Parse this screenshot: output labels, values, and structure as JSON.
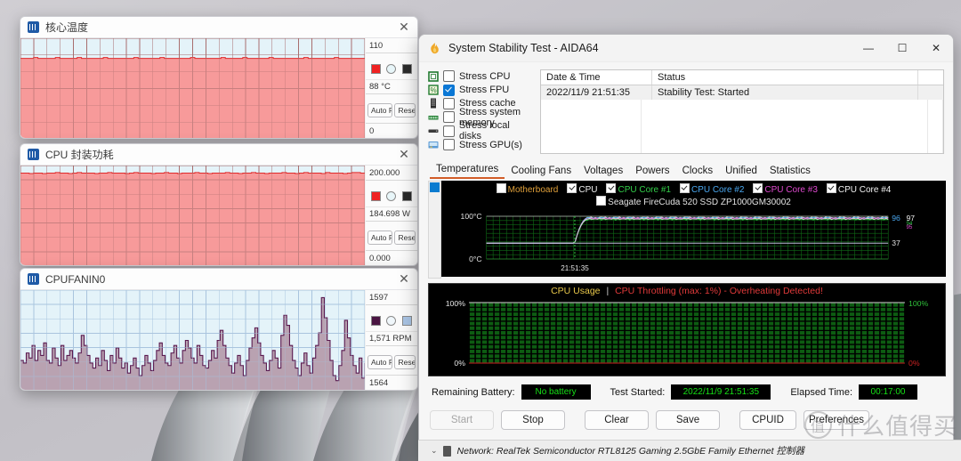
{
  "desktop": {
    "wallpaper_alt": "fan-blades-wallpaper"
  },
  "watermark": {
    "badge": "值",
    "text": "什么值得买"
  },
  "sensor_panels": [
    {
      "title": "核心温度",
      "icon": "sensor-panel-icon",
      "close_label": "✕",
      "max_label": "110",
      "min_label": "0",
      "current_value": "88 °C",
      "auto_fit_label": "Auto Fit",
      "reset_label": "Reset",
      "swatches": [
        "#ef2222",
        "#e8f6f9",
        "#2b2b2b"
      ],
      "series_color": "#ef3b3b",
      "fill_color": "#f79d9d",
      "grid_color": "#b07a7a",
      "bg_color": "#e4f3f9"
    },
    {
      "title": "CPU 封装功耗",
      "icon": "sensor-panel-icon",
      "close_label": "✕",
      "max_label": "200.000",
      "min_label": "0.000",
      "current_value": "184.698 W",
      "auto_fit_label": "Auto Fit",
      "reset_label": "Reset",
      "swatches": [
        "#ef2222",
        "#e8f6f9",
        "#2b2b2b"
      ],
      "series_color": "#ef3b3b",
      "fill_color": "#f79d9d",
      "grid_color": "#b07a7a",
      "bg_color": "#e4f3f9"
    },
    {
      "title": "CPUFANIN0",
      "icon": "sensor-panel-icon",
      "close_label": "✕",
      "max_label": "1597",
      "min_label": "1564",
      "current_value": "1,571 RPM",
      "auto_fit_label": "Auto Fit",
      "reset_label": "Reset",
      "swatches": [
        "#4a1542",
        "#f0f7fb",
        "#a9c4e4"
      ],
      "series_color": "#5a1a50",
      "fill_color": "#b69dad",
      "grid_color": "#aec6de",
      "bg_color": "#e4f3f9"
    }
  ],
  "aida": {
    "window_title": "System Stability Test - AIDA64",
    "window_icon": "aida64-flame-icon",
    "window_buttons": {
      "minimize": "—",
      "maximize": "☐",
      "close": "✕"
    },
    "stress_options": [
      {
        "label": "Stress CPU",
        "checked": false,
        "icon": "cpu-icon"
      },
      {
        "label": "Stress FPU",
        "checked": true,
        "icon": "fpu-icon"
      },
      {
        "label": "Stress cache",
        "checked": false,
        "icon": "cache-icon"
      },
      {
        "label": "Stress system memory",
        "checked": false,
        "icon": "memory-icon"
      },
      {
        "label": "Stress local disks",
        "checked": false,
        "icon": "disk-icon"
      },
      {
        "label": "Stress GPU(s)",
        "checked": false,
        "icon": "gpu-icon"
      }
    ],
    "log": {
      "columns": [
        "Date & Time",
        "Status"
      ],
      "rows": [
        {
          "datetime": "2022/11/9 21:51:35",
          "status": "Stability Test: Started"
        }
      ]
    },
    "tabs": [
      {
        "label": "Temperatures",
        "active": true
      },
      {
        "label": "Cooling Fans",
        "active": false
      },
      {
        "label": "Voltages",
        "active": false
      },
      {
        "label": "Powers",
        "active": false
      },
      {
        "label": "Clocks",
        "active": false
      },
      {
        "label": "Unified",
        "active": false
      },
      {
        "label": "Statistics",
        "active": false
      }
    ],
    "temp_legend_row1": [
      {
        "label": "Motherboard",
        "checked": false,
        "color": "#e0a03a"
      },
      {
        "label": "CPU",
        "checked": true,
        "color": "#f2f2f2"
      },
      {
        "label": "CPU Core #1",
        "checked": true,
        "color": "#33d14a"
      },
      {
        "label": "CPU Core #2",
        "checked": true,
        "color": "#4aa8f0"
      },
      {
        "label": "CPU Core #3",
        "checked": true,
        "color": "#e04ad0"
      },
      {
        "label": "CPU Core #4",
        "checked": true,
        "color": "#f2f2f2"
      }
    ],
    "temp_legend_row2": [
      {
        "label": "Seagate FireCuda 520 SSD ZP1000GM30002",
        "checked": false,
        "color": "#e2e2e2"
      }
    ],
    "status_bar": {
      "battery_label": "Remaining Battery:",
      "battery_value": "No battery",
      "started_label": "Test Started:",
      "started_value": "2022/11/9 21:51:35",
      "elapsed_label": "Elapsed Time:",
      "elapsed_value": "00:17:00"
    },
    "buttons": [
      {
        "label": "Start",
        "disabled": true
      },
      {
        "label": "Stop",
        "disabled": false
      },
      {
        "label": "Clear",
        "disabled": false
      },
      {
        "label": "Save",
        "disabled": false
      },
      {
        "label": "CPUID",
        "disabled": false
      },
      {
        "label": "Preferences",
        "disabled": false
      }
    ]
  },
  "bottom_strip": {
    "chevron": "⌄",
    "icon": "device-icon",
    "text": "Network: RealTek Semiconductor RTL8125 Gaming 2.5GbE Family Ethernet 控制器"
  },
  "chart_data": [
    {
      "type": "line",
      "name": "temperatures-chart",
      "title": "",
      "xlabel": "",
      "ylabel": "°C",
      "ylim": [
        0,
        100
      ],
      "y_tick_labels": [
        "100°C",
        "0°C"
      ],
      "x_tick_labels": [
        "21:51:35"
      ],
      "grid": true,
      "grid_color": "#0f6b16",
      "background": "#000000",
      "right_value_labels": [
        "96",
        "97",
        "37"
      ],
      "series": [
        {
          "name": "CPU",
          "color": "#f2f2f2",
          "value": 97,
          "baseline": 37,
          "ramp_at": 0.22
        },
        {
          "name": "CPU Core #1",
          "color": "#33d14a",
          "value": 93,
          "baseline": 37,
          "ramp_at": 0.22
        },
        {
          "name": "CPU Core #2",
          "color": "#4aa8f0",
          "value": 96,
          "baseline": 37,
          "ramp_at": 0.22
        },
        {
          "name": "CPU Core #3",
          "color": "#e04ad0",
          "value": 95,
          "baseline": 37,
          "ramp_at": 0.22
        },
        {
          "name": "CPU Core #4",
          "color": "#d8d8d8",
          "value": 94,
          "baseline": 37,
          "ramp_at": 0.22
        },
        {
          "name": "Flat line (37)",
          "color": "#b9b9d6",
          "value": 37,
          "baseline": 37,
          "ramp_at": 0
        }
      ]
    },
    {
      "type": "line",
      "name": "cpu-usage-chart",
      "title_main": "CPU Usage",
      "title_sep": "|",
      "title_alert": "CPU Throttling (max: 1%) - Overheating Detected!",
      "ylim": [
        0,
        100
      ],
      "y_tick_labels_left": [
        "100%",
        "0%"
      ],
      "y_tick_labels_right": [
        "100%",
        "0%"
      ],
      "grid": true,
      "grid_color": "#0f6b16",
      "background": "#000000",
      "series": [
        {
          "name": "CPU Usage",
          "color": "#16c91e",
          "value": 100
        },
        {
          "name": "CPU Throttling",
          "color": "#cc2222",
          "value": 1
        }
      ]
    },
    {
      "type": "area",
      "name": "core-temperature-panel-chart",
      "ylim": [
        0,
        110
      ],
      "unit": "°C",
      "current": 88,
      "values": [
        88,
        88,
        88,
        89,
        88,
        88,
        88,
        88,
        89,
        88,
        88,
        88,
        88,
        89,
        88,
        88,
        88,
        88,
        88,
        89,
        88,
        88,
        88,
        88,
        88,
        88,
        89,
        88,
        88,
        88,
        88,
        88,
        89,
        88,
        88,
        88,
        88,
        88,
        88,
        89,
        88,
        88,
        88,
        88,
        88,
        88,
        89,
        88,
        88,
        88,
        88,
        89,
        88,
        88,
        88,
        88,
        88,
        89,
        88,
        88,
        88,
        88,
        88,
        88,
        88,
        89,
        88,
        88,
        88,
        88,
        88,
        88,
        89,
        88,
        88,
        88,
        88,
        88,
        88,
        88
      ]
    },
    {
      "type": "area",
      "name": "cpu-package-power-panel-chart",
      "ylim": [
        0,
        200
      ],
      "unit": "W",
      "current": 184.698,
      "values": [
        185,
        185,
        184,
        185,
        185,
        184,
        185,
        185,
        186,
        185,
        185,
        184,
        185,
        186,
        185,
        185,
        185,
        184,
        185,
        185,
        186,
        185,
        185,
        185,
        184,
        185,
        186,
        185,
        185,
        185,
        184,
        185,
        185,
        186,
        185,
        185,
        184,
        185,
        185,
        185,
        186,
        185,
        185,
        184,
        185,
        185,
        185,
        186,
        185,
        185,
        184,
        185,
        185,
        186,
        185,
        185,
        184,
        185,
        185,
        185,
        186,
        185,
        185,
        184,
        185,
        186,
        185,
        185,
        185,
        184,
        186,
        185,
        185,
        185,
        184,
        185,
        186,
        186,
        185,
        185
      ]
    },
    {
      "type": "area",
      "name": "cpu-fan-rpm-panel-chart",
      "ylim": [
        1564,
        1597
      ],
      "unit": "RPM",
      "current": 1571,
      "values": [
        1572,
        1571,
        1575,
        1573,
        1578,
        1572,
        1576,
        1574,
        1579,
        1572,
        1571,
        1577,
        1573,
        1570,
        1578,
        1572,
        1574,
        1576,
        1573,
        1571,
        1575,
        1582,
        1578,
        1574,
        1571,
        1569,
        1573,
        1570,
        1576,
        1572,
        1568,
        1574,
        1571,
        1577,
        1573,
        1569,
        1571,
        1567,
        1570,
        1573,
        1569,
        1566,
        1570,
        1574,
        1571,
        1568,
        1572,
        1576,
        1579,
        1574,
        1571,
        1570,
        1575,
        1578,
        1573,
        1571,
        1576,
        1580,
        1577,
        1573,
        1571,
        1578,
        1574,
        1570,
        1569,
        1572,
        1576,
        1573,
        1580,
        1584,
        1578,
        1573,
        1570,
        1567,
        1571,
        1574,
        1570,
        1566,
        1572,
        1577,
        1581,
        1585,
        1579,
        1574,
        1571,
        1568,
        1572,
        1576,
        1573,
        1569,
        1582,
        1590,
        1586,
        1578,
        1572,
        1569,
        1566,
        1571,
        1575,
        1570,
        1567,
        1573,
        1578,
        1583,
        1597,
        1589,
        1580,
        1572,
        1566,
        1564,
        1570,
        1576,
        1588,
        1581,
        1574,
        1570,
        1567,
        1573,
        1565,
        1571
      ]
    }
  ]
}
